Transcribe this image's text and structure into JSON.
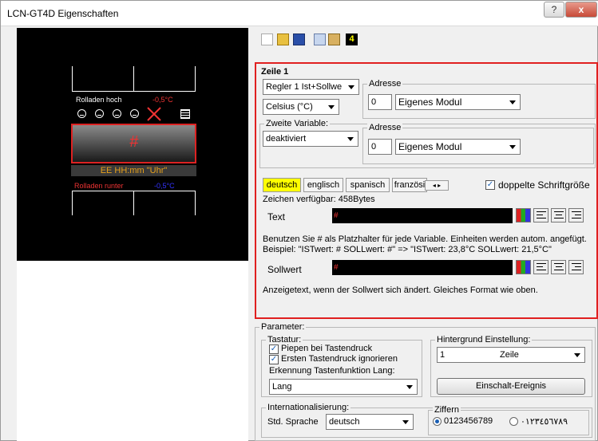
{
  "window": {
    "title": "LCN-GT4D Eigenschaften",
    "help_label": "?",
    "close_label": "x"
  },
  "toolbar": {
    "icons": [
      "new-file-icon",
      "open-folder-icon",
      "save-icon",
      "copy-icon",
      "paste-icon",
      "display-4-icon"
    ],
    "badge": "4"
  },
  "preview": {
    "top_left_label": "Rolladen hoch",
    "top_right_value": "-0,5°C",
    "center_symbol": "#",
    "bar_text": "EE HH:mm \"Uhr\"",
    "bottom_left_label": "Rolladen runter",
    "bottom_right_value": "-0,5°C"
  },
  "zeile": {
    "heading": "Zeile 1",
    "regler_select": "Regler 1 Ist+Sollwe",
    "unit_select": "Celsius (°C)",
    "adresse1_label": "Adresse",
    "adresse1_value": "0",
    "adresse1_module": "Eigenes Modul",
    "zweite_label": "Zweite Variable:",
    "zweite_select": "deaktiviert",
    "adresse2_label": "Adresse",
    "adresse2_value": "0",
    "adresse2_module": "Eigenes Modul",
    "tabs": [
      "deutsch",
      "englisch",
      "spanisch",
      "französi"
    ],
    "double_font_label": "doppelte Schriftgröße",
    "chars_available": "Zeichen verfügbar: 458Bytes",
    "text_label": "Text",
    "text_value": "#",
    "hint1": "Benutzen Sie # als Platzhalter für jede Variable. Einheiten werden autom. angefügt.",
    "hint2": "Beispiel: \"ISTwert: # SOLLwert: #\"   =>   \"ISTwert: 23,8°C SOLLwert: 21,5°C\"",
    "sollwert_label": "Sollwert",
    "sollwert_value": "#",
    "hint3": "Anzeigetext, wenn der Sollwert sich ändert. Gleiches Format wie oben."
  },
  "parameter": {
    "label": "Parameter:",
    "tastatur_label": "Tastatur:",
    "chk1": "Piepen bei Tastendruck",
    "chk2": "Ersten Tastendruck ignorieren",
    "erkennung_label": "Erkennung Tastenfunktion Lang:",
    "erkennung_select": "Lang",
    "hintergrund_label": "Hintergrund Einstellung:",
    "hg_number": "1",
    "hg_select": "Zeile",
    "einschalt_button": "Einschalt-Ereignis",
    "intl_label": "Internationalisierung:",
    "std_sprache_label": "Std. Sprache",
    "std_sprache_select": "deutsch",
    "ziffern_label": "Ziffern",
    "ziffern_opt1": "0123456789",
    "ziffern_opt2": "٠١٢٣٤٥٦٧٨٩"
  }
}
